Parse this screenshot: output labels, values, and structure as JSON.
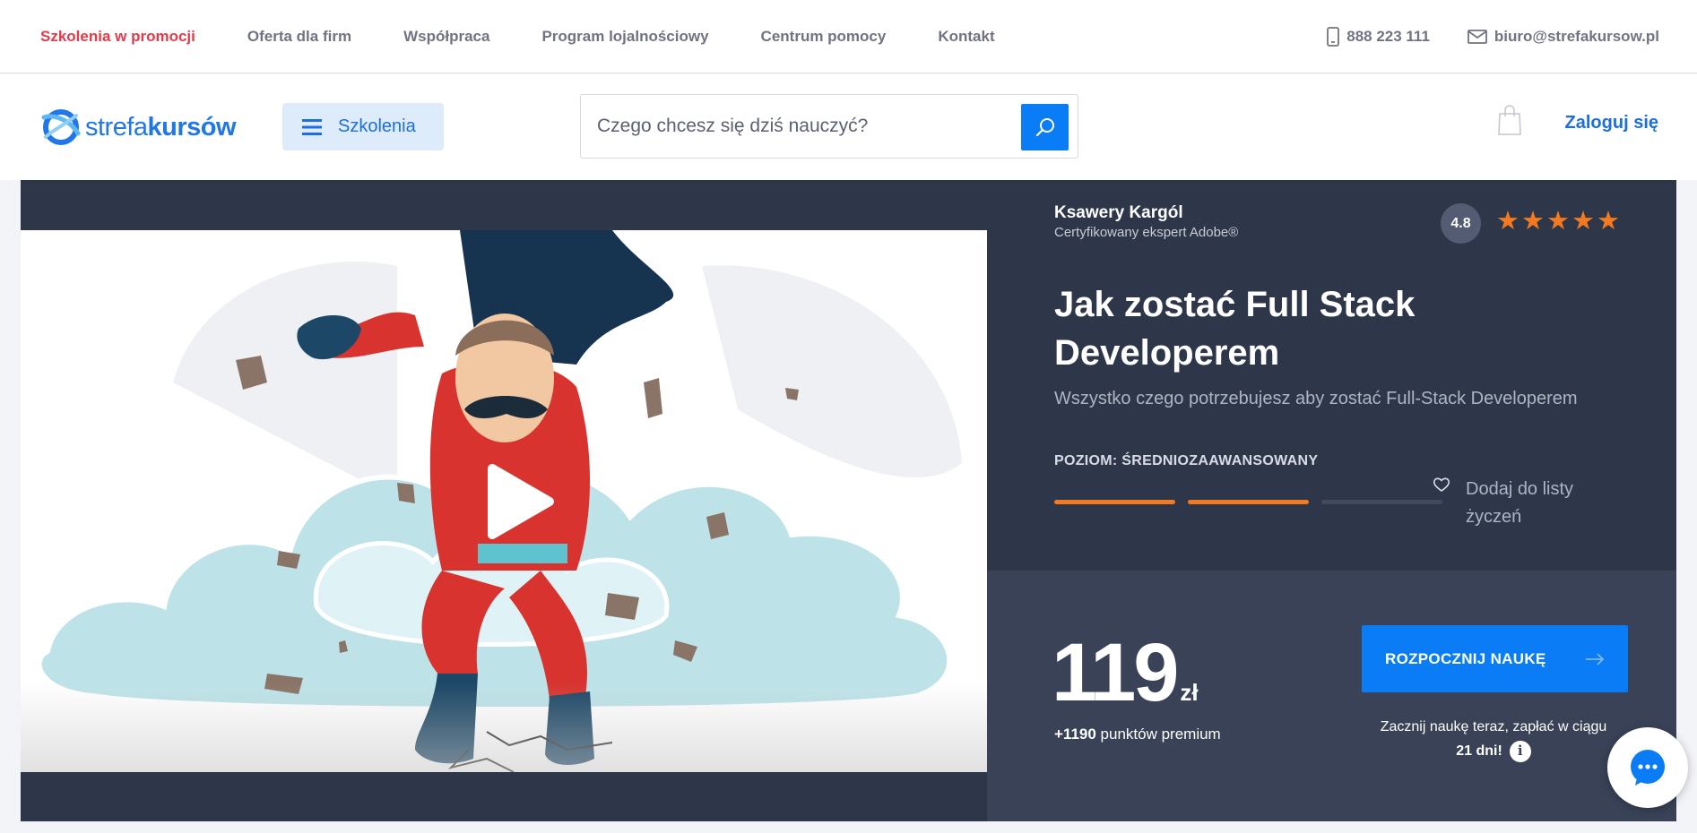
{
  "topnav": {
    "items": [
      {
        "label": "Szkolenia w promocji"
      },
      {
        "label": "Oferta dla firm"
      },
      {
        "label": "Współpraca"
      },
      {
        "label": "Program lojalnościowy"
      },
      {
        "label": "Centrum pomocy"
      },
      {
        "label": "Kontakt"
      }
    ],
    "phone": "888 223 111",
    "email": "biuro@strefakursow.pl"
  },
  "header": {
    "logo_light": "strefa",
    "logo_bold": "kursów",
    "menu_label": "Szkolenia",
    "search_placeholder": "Czego chcesz się dziś nauczyć?",
    "login_label": "Zaloguj się"
  },
  "course": {
    "author_name": "Ksawery Kargól",
    "author_role": "Certyfikowany ekspert Adobe®",
    "rating": "4.8",
    "stars": 5,
    "title": "Jak zostać Full Stack Developerem",
    "subtitle": "Wszystko czego potrzebujesz aby zostać Full-Stack Developerem",
    "level_label": "POZIOM: ŚREDNIOZAAWANSOWANY",
    "level": 2,
    "level_max": 3,
    "wishlist_label": "Dodaj do listy życzeń"
  },
  "purchase": {
    "price": "119",
    "currency": "zł",
    "points_value": "+1190",
    "points_label": "punktów premium",
    "cta_label": "ROZPOCZNIJ NAUKĘ",
    "pay_later_text": "Zacznij naukę teraz, zapłać w ciągu",
    "pay_later_days": "21 dni!"
  },
  "colors": {
    "accent": "#0a7cf5",
    "orange": "#f37a20",
    "hero_bg": "#2e3649",
    "buy_bg": "#394257",
    "promo_red": "#e33b4a"
  },
  "icons": [
    "phone-icon",
    "mail-icon",
    "hamburger-icon",
    "search-icon",
    "cart-icon",
    "play-icon",
    "heart-icon",
    "arrow-right-icon",
    "info-icon",
    "chat-icon"
  ]
}
